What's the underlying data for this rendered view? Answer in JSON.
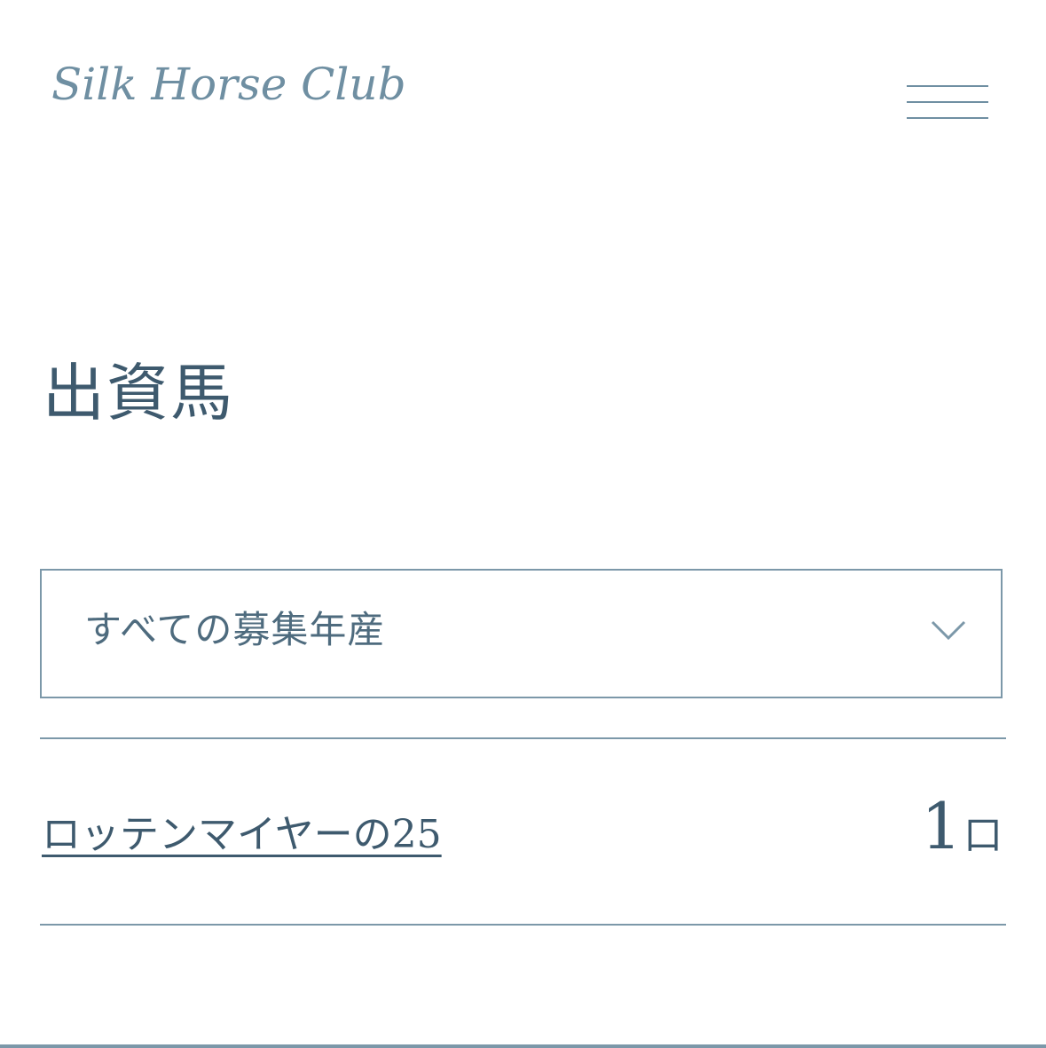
{
  "header": {
    "logo_text": "Silk Horse Club",
    "menu_icon": "hamburger-menu-icon"
  },
  "page": {
    "title": "出資馬"
  },
  "filter": {
    "selected": "すべての募集年産",
    "icon": "chevron-down-icon"
  },
  "horses": [
    {
      "name": "ロッテンマイヤーの25",
      "count": "1",
      "unit": "口"
    }
  ],
  "colors": {
    "primary": "#3e5a6e",
    "accent": "#7c98a9",
    "logo": "#6f8fa2"
  }
}
